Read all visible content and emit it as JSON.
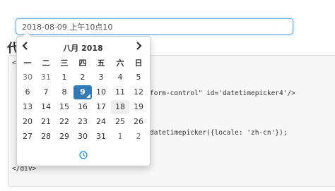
{
  "input": {
    "value": "2018-08-09 上午10点10"
  },
  "page": {
    "heading": "代",
    "code_lines": [
      "<",
      "",
      "",
      "form-control\" id='datetimepicker4'/>",
      "",
      "",
      "datetimepicker({locale: 'zh-cn'});",
      "",
      "",
      "",
      "</div>"
    ]
  },
  "picker": {
    "month_title": "八月 2018",
    "prev_icon": "chevron-left-icon",
    "next_icon": "chevron-right-icon",
    "weekdays": [
      "一",
      "二",
      "三",
      "四",
      "五",
      "六",
      "日"
    ],
    "weeks": [
      [
        "30",
        "31",
        "1",
        "2",
        "3",
        "4",
        "5"
      ],
      [
        "6",
        "7",
        "8",
        "9",
        "10",
        "11",
        "12"
      ],
      [
        "13",
        "14",
        "15",
        "16",
        "17",
        "18",
        "19"
      ],
      [
        "20",
        "21",
        "22",
        "23",
        "24",
        "25",
        "26"
      ],
      [
        "27",
        "28",
        "29",
        "30",
        "31",
        "1",
        "2"
      ]
    ],
    "selected_day": "9",
    "today_day": "18",
    "time_icon": "clock-icon",
    "colors": {
      "accent": "#337ab7",
      "focus": "#66afe9",
      "icon": "#2a9fd6"
    }
  }
}
